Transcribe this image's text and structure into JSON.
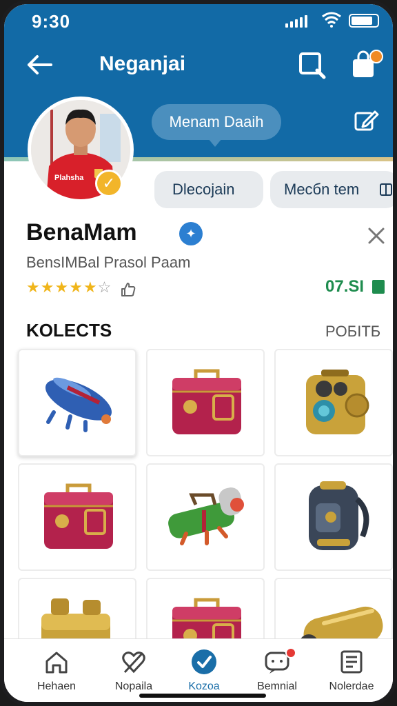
{
  "status_bar": {
    "time": "9:30"
  },
  "header": {
    "title": "Neganjai",
    "bubble": "Menam Daaih"
  },
  "colors": {
    "header": "#126aa6",
    "accent_green": "#1e8c4e",
    "star": "#f0b51a",
    "verified": "#f2b52a",
    "active_tab": "#1a6ea8"
  },
  "tabs": [
    {
      "label": "Dlecojain"
    },
    {
      "label": "Mecбn tem"
    }
  ],
  "profile": {
    "name": "BenaMam",
    "subtitle": "BensIMBal Prasol Paam",
    "rating_stars": 4.5,
    "amount": "07.SI",
    "jersey_text": "Plahsha"
  },
  "collection": {
    "title": "KOLECTS",
    "link": "POБITБ",
    "items": [
      {
        "icon": "blue-capsule-robot"
      },
      {
        "icon": "red-suitcase"
      },
      {
        "icon": "gold-camera-device"
      },
      {
        "icon": "red-suitcase"
      },
      {
        "icon": "green-cannon-robot"
      },
      {
        "icon": "dark-backpack"
      },
      {
        "icon": "gold-chest"
      },
      {
        "icon": "red-suitcase"
      },
      {
        "icon": "gold-telescope"
      }
    ]
  },
  "nav": [
    {
      "label": "Hehaen",
      "icon": "home-icon"
    },
    {
      "label": "Nopaila",
      "icon": "heart-slash-icon"
    },
    {
      "label": "Kozoa",
      "icon": "check-circle-icon",
      "active": true
    },
    {
      "label": "Bemnial",
      "icon": "chat-icon",
      "badge": true
    },
    {
      "label": "Nolerdae",
      "icon": "list-icon"
    }
  ]
}
